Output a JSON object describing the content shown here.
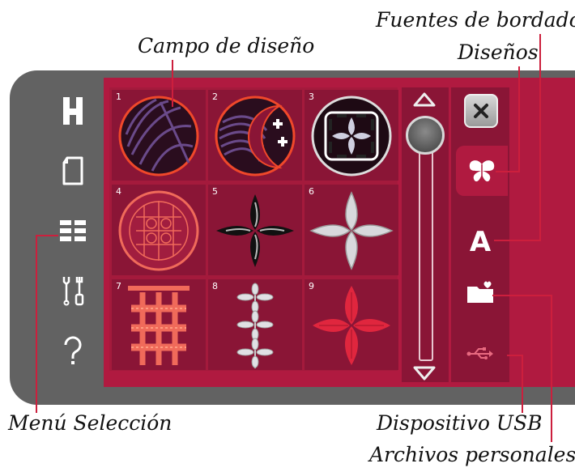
{
  "callouts": {
    "campo": "Campo de diseño",
    "fuentes": "Fuentes de bordado",
    "disenos": "Diseños",
    "menu": "Menú Selección",
    "usb": "Dispositivo USB",
    "archivos": "Archivos personales"
  },
  "sidebar": {
    "items": [
      {
        "icon": "machine-mode-icon"
      },
      {
        "icon": "embroidery-mode-icon"
      },
      {
        "icon": "selection-menu-icon"
      },
      {
        "icon": "settings-tools-icon"
      },
      {
        "icon": "help-icon"
      }
    ]
  },
  "designs": [
    {
      "num": "1"
    },
    {
      "num": "2"
    },
    {
      "num": "3"
    },
    {
      "num": "4"
    },
    {
      "num": "5"
    },
    {
      "num": "6"
    },
    {
      "num": "7"
    },
    {
      "num": "8"
    },
    {
      "num": "9"
    }
  ],
  "tabs": {
    "fonts_label": "A"
  },
  "colors": {
    "screen": "#b01a40",
    "cell": "#8a1536",
    "bezel": "#626262",
    "accent": "#cc1f3d"
  }
}
